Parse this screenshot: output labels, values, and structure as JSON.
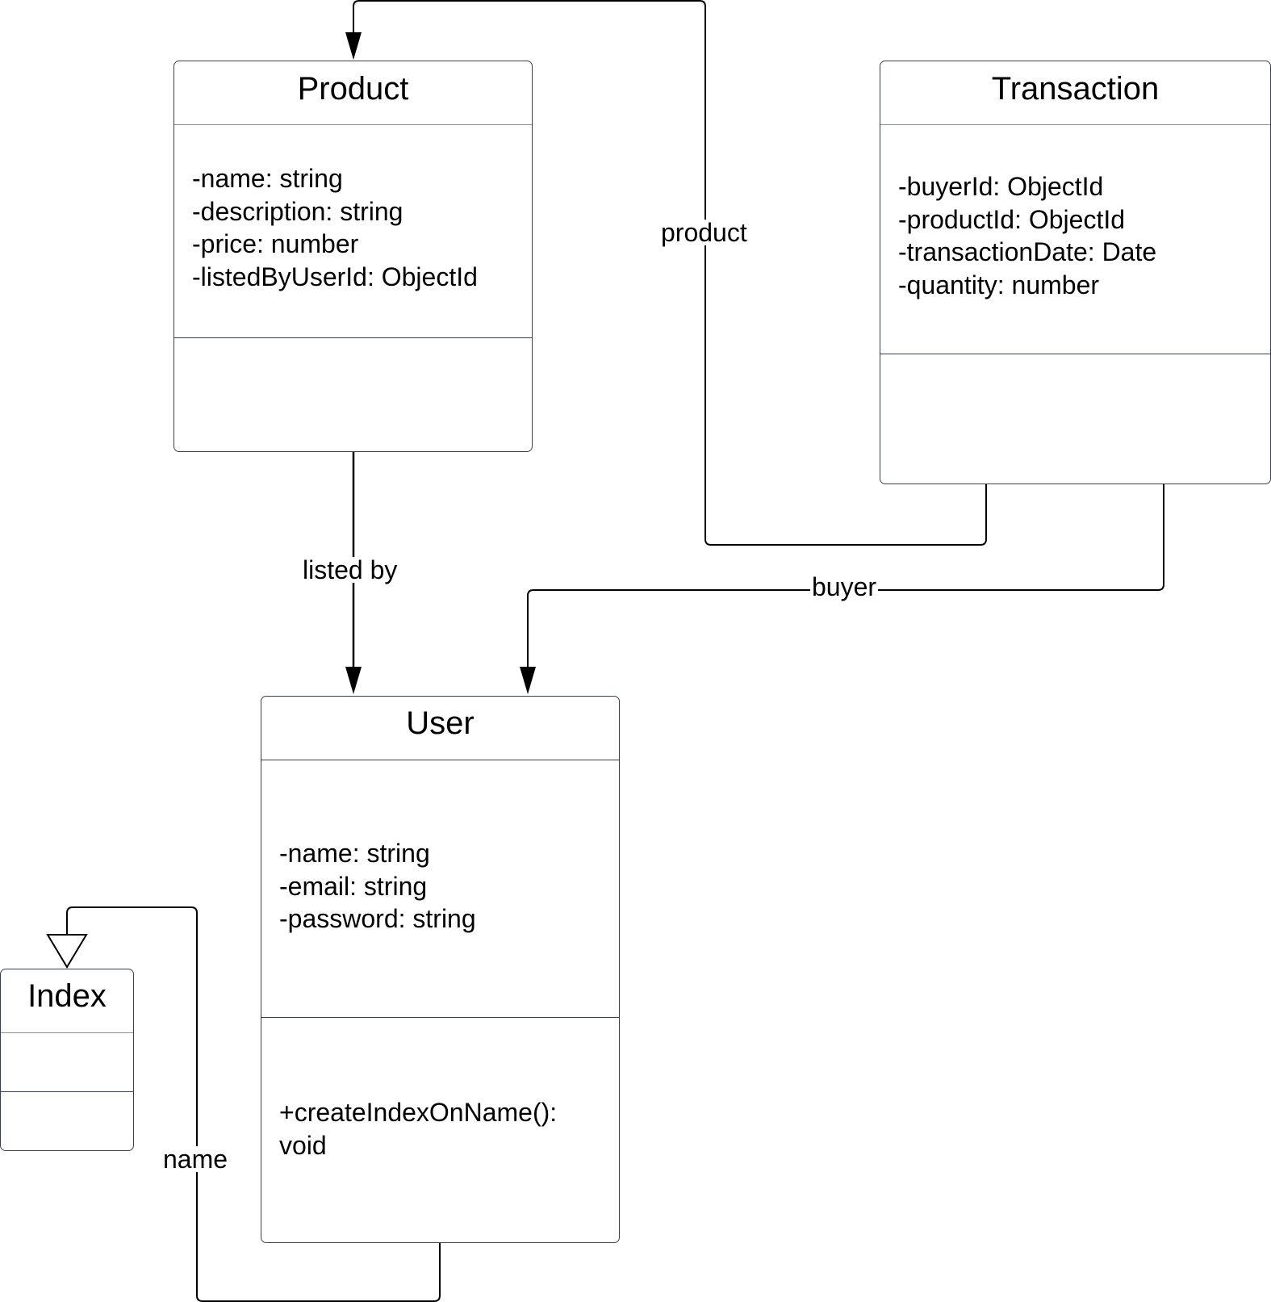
{
  "classes": {
    "product": {
      "name": "Product",
      "attributes": [
        "-name: string",
        "-description: string",
        "-price: number",
        "-listedByUserId: ObjectId"
      ],
      "methods": []
    },
    "transaction": {
      "name": "Transaction",
      "attributes": [
        "-buyerId: ObjectId",
        "-productId: ObjectId",
        "-transactionDate: Date",
        "-quantity: number"
      ],
      "methods": []
    },
    "user": {
      "name": "User",
      "attributes": [
        "-name: string",
        "-email: string",
        "-password: string"
      ],
      "methods": [
        "+createIndexOnName():",
        "void"
      ]
    },
    "index": {
      "name": "Index",
      "attributes": [],
      "methods": []
    }
  },
  "relationships": {
    "product_label": "product",
    "listed_by_label": "listed by",
    "buyer_label": "buyer",
    "name_label": "name"
  },
  "colors": {
    "line": "#000000",
    "border": "#3b3f4a"
  }
}
